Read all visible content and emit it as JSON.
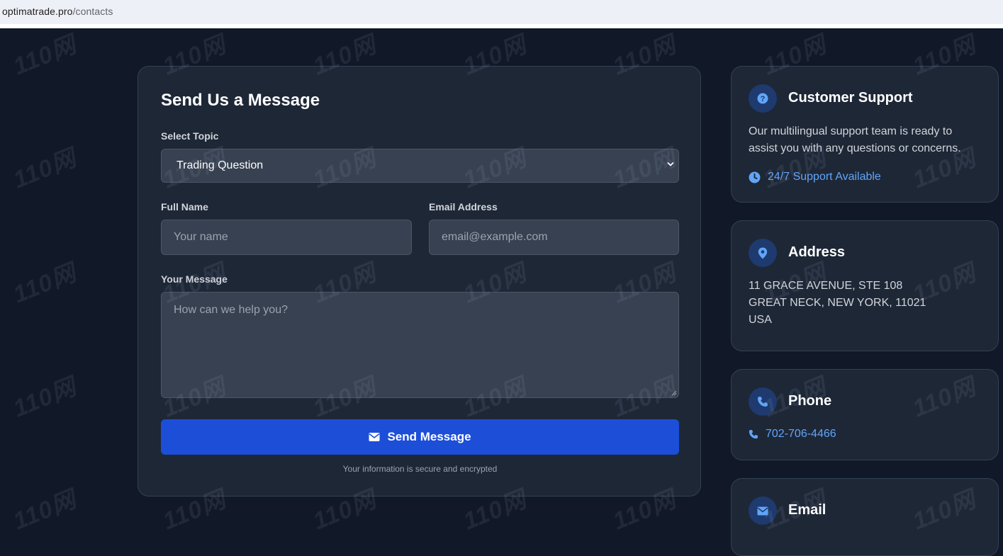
{
  "browser": {
    "url_host": "optimatrade.pro",
    "url_path": "/contacts"
  },
  "form": {
    "title": "Send Us a Message",
    "topic_label": "Select Topic",
    "topic_value": "Trading Question",
    "name_label": "Full Name",
    "name_placeholder": "Your name",
    "email_label": "Email Address",
    "email_placeholder": "email@example.com",
    "message_label": "Your Message",
    "message_placeholder": "How can we help you?",
    "submit_label": "Send Message",
    "secure_note": "Your information is secure and encrypted"
  },
  "support": {
    "title": "Customer Support",
    "line1": "Our multilingual support team is ready to",
    "line2": "assist you with any questions or concerns.",
    "availability": "24/7 Support Available"
  },
  "address": {
    "title": "Address",
    "line1": "11 GRACE AVENUE, STE 108",
    "line2": "GREAT NECK, NEW YORK, 11021",
    "line3": "USA"
  },
  "phone": {
    "title": "Phone",
    "number": "702-706-4466"
  },
  "email": {
    "title": "Email"
  },
  "watermark": {
    "text": "110网"
  },
  "colors": {
    "page_bg": "#111827",
    "card_bg": "#1e2736",
    "accent": "#1d4ed8",
    "link": "#60a5fa"
  },
  "icons": {
    "support": "question-circle-icon",
    "availability": "clock-icon",
    "address": "map-pin-icon",
    "phone": "phone-icon",
    "email": "envelope-icon",
    "submit": "envelope-icon"
  }
}
